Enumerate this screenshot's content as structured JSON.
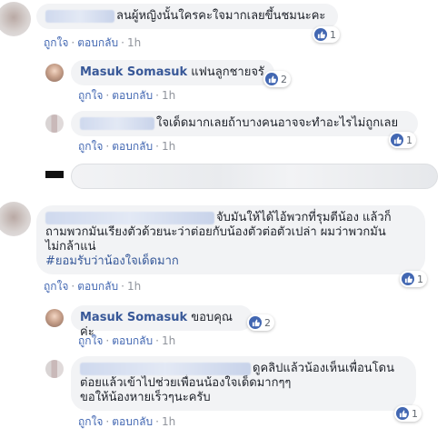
{
  "actions": {
    "like": "ถูกใจ",
    "reply": "ตอบกลับ",
    "dot": "·",
    "time": "1h"
  },
  "comments": [
    {
      "text": "ลนผู้หญิงนั้นใครคะใจมากเลยขึ้นชมนะคะ",
      "reactions": "1"
    },
    {
      "author": "Masuk Somasuk",
      "text": "แฟนลูกชายจรั",
      "reactions": "2"
    },
    {
      "text": "ใจเด็ดมากเลยถ้าบางคนอาจจะทำอะไรไม่ถูกเลย",
      "reactions": "1"
    },
    {
      "lines": [
        "จับมันให้ได้ไอ้พวกที่รุมตีน้อง แล้วก็",
        "ถามพวกมันเรียงตัวด้วยนะว่าต่อยกับน้องตัวต่อตัวเปล่า ผมว่าพวกมัน",
        "ไม่กล้าแน่"
      ],
      "hashtag": "#ยอมรับว่าน้องใจเด็ดมาก",
      "reactions": "1"
    },
    {
      "author": "Masuk Somasuk",
      "text": "ขอบคุณค่ะ",
      "reactions": "2"
    },
    {
      "lines": [
        "ดูคลิปแล้วน้องเห็นเพื่อนโดน",
        "ต่อยแล้วเข้าไปช่วยเพื่อนน้องใจเด็ดมากๆๆ",
        "ขอให้น้องหายเร็วๆนะครับ"
      ],
      "reactions": "1"
    }
  ],
  "colors": {
    "link": "#385898",
    "like_blue": "#4267b2",
    "bubble": "#f2f3f5"
  }
}
